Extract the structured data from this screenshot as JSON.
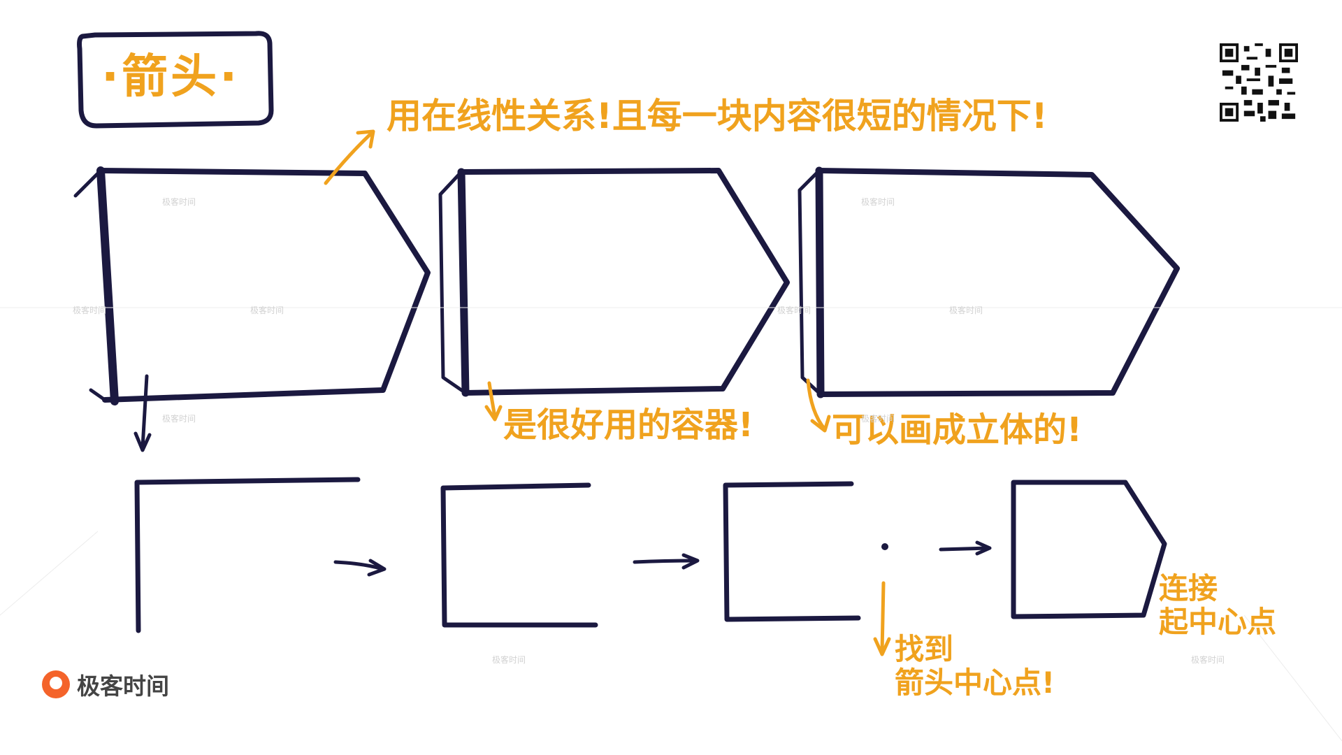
{
  "title": "·箭头·",
  "annotations": {
    "linear_relation": "用在线性关系!且每一块内容很短的情况下!",
    "good_container": "是很好用的容器!",
    "three_d": "可以画成立体的!",
    "find_center": "找到\n箭头中心点!",
    "connect_center": "连接\n起中心点"
  },
  "brand": {
    "logo_text": "极客时间",
    "watermark": "极客时间"
  },
  "colors": {
    "ink": "#1b1940",
    "accent": "#f0a21e",
    "logo": "#f4632a",
    "watermark": "#d2d2d2"
  },
  "icons": {
    "qr": "qr-code-icon",
    "logo": "geektime-logo-icon"
  }
}
